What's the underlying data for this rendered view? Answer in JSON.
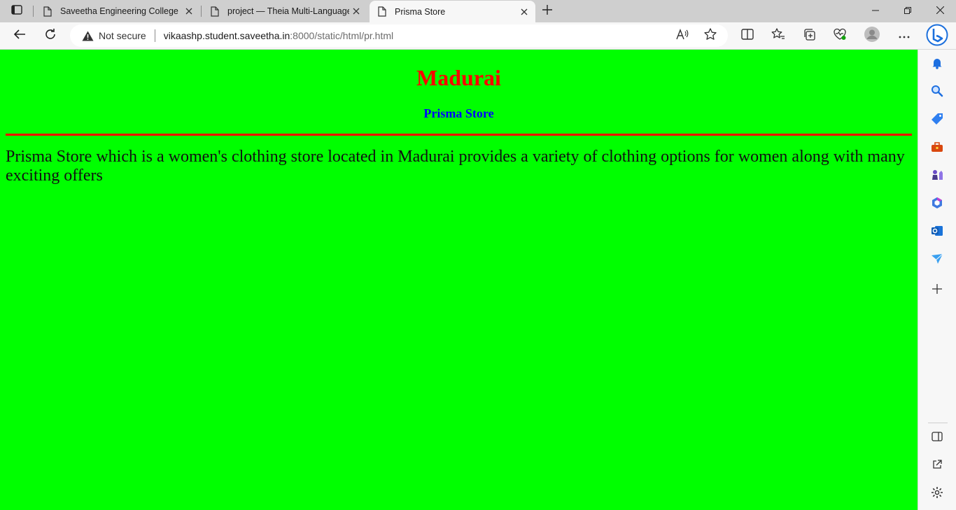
{
  "tabs": [
    {
      "title": "Saveetha Engineering College"
    },
    {
      "title": "project — Theia Multi-Language"
    },
    {
      "title": "Prisma Store"
    }
  ],
  "address": {
    "security_label": "Not secure",
    "url_host": "vikaashp.student.saveetha.in",
    "url_rest": ":8000/static/html/pr.html"
  },
  "page": {
    "heading": "Madurai",
    "subheading": "Prisma Store",
    "paragraph": "Prisma Store which is a women's clothing store located in Madurai provides a variety of clothing options for women along with many exciting offers"
  },
  "colors": {
    "page_background": "#00ff00",
    "heading": "#ff0000",
    "subheading": "#0000ff",
    "rule": "#ff0000"
  },
  "icons": {
    "tab_actions": "tab-actions-icon",
    "page": "page-icon",
    "close": "close-icon",
    "new_tab": "plus-icon",
    "back": "back-arrow-icon",
    "refresh": "refresh-icon",
    "warning": "warning-triangle-icon",
    "read_aloud": "read-aloud-icon",
    "favorite": "star-icon",
    "split_screen": "split-screen-icon",
    "favorites": "favorites-list-icon",
    "collections": "collections-icon",
    "browser_essentials": "heart-pulse-icon",
    "profile": "avatar-icon",
    "more": "more-icon",
    "bing": "bing-icon"
  }
}
